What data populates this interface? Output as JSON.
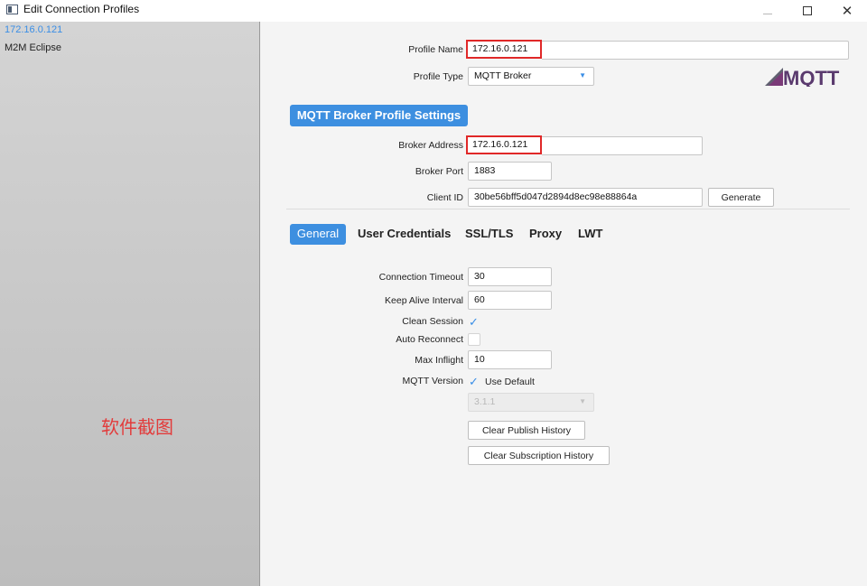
{
  "window": {
    "title": "Edit Connection Profiles",
    "close_glyph": "✕"
  },
  "sidebar": {
    "items": [
      {
        "label": "172.16.0.121",
        "selected": true
      },
      {
        "label": "M2M Eclipse",
        "selected": false
      }
    ],
    "watermark": "软件截图"
  },
  "profile": {
    "name_label": "Profile Name",
    "name_value": "172.16.0.121",
    "type_label": "Profile Type",
    "type_value": "MQTT Broker",
    "logo_text": "MQTT"
  },
  "broker": {
    "section_title": "MQTT Broker Profile Settings",
    "address_label": "Broker Address",
    "address_value": "172.16.0.121",
    "port_label": "Broker Port",
    "port_value": "1883",
    "client_id_label": "Client ID",
    "client_id_value": "30be56bff5d047d2894d8ec98e88864a",
    "generate_label": "Generate"
  },
  "tabs": [
    {
      "label": "General",
      "active": true
    },
    {
      "label": "User Credentials",
      "active": false
    },
    {
      "label": "SSL/TLS",
      "active": false
    },
    {
      "label": "Proxy",
      "active": false
    },
    {
      "label": "LWT",
      "active": false
    }
  ],
  "general": {
    "connection_timeout_label": "Connection Timeout",
    "connection_timeout_value": "30",
    "keep_alive_label": "Keep Alive Interval",
    "keep_alive_value": "60",
    "clean_session_label": "Clean Session",
    "clean_session_checked": true,
    "auto_reconnect_label": "Auto Reconnect",
    "auto_reconnect_checked": false,
    "max_inflight_label": "Max Inflight",
    "max_inflight_value": "10",
    "mqtt_version_label": "MQTT Version",
    "use_default_label": "Use Default",
    "use_default_checked": true,
    "version_value": "3.1.1",
    "clear_publish_label": "Clear Publish History",
    "clear_subscription_label": "Clear Subscription History"
  },
  "colors": {
    "accent": "#3d8fe0",
    "highlight_border": "#e02828",
    "watermark": "#e23c3c"
  }
}
